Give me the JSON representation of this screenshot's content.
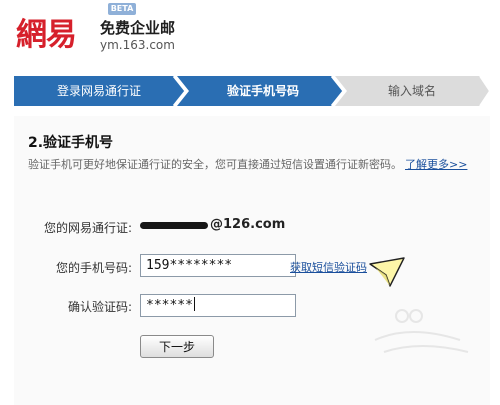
{
  "header": {
    "logo_text": "網易",
    "product_name": "免费企业邮",
    "beta_badge": "BETA",
    "site_url": "ym.163.com"
  },
  "steps": [
    {
      "label": "登录网易通行证",
      "state": "done"
    },
    {
      "label": "验证手机号码",
      "state": "current"
    },
    {
      "label": "输入域名",
      "state": "pending"
    }
  ],
  "colors": {
    "step_active": "#2a6eb3",
    "step_inactive": "#dcdcdc",
    "link": "#1a4f9c",
    "logo_red": "#d6202b"
  },
  "section": {
    "title": "2.验证手机号",
    "description": "验证手机可更好地保证通行证的安全，您可直接通过短信设置通行证新密码。",
    "learn_more": "了解更多>>"
  },
  "form": {
    "account_label": "您的网易通行证:",
    "account_domain": "@126.com",
    "phone_label": "您的手机号码:",
    "phone_value": "159********",
    "get_code_link": "获取短信验证码",
    "code_label": "确认验证码:",
    "code_value": "******",
    "next_button": "下一步"
  },
  "icons": {
    "pointer": "arrow-cursor-icon"
  }
}
